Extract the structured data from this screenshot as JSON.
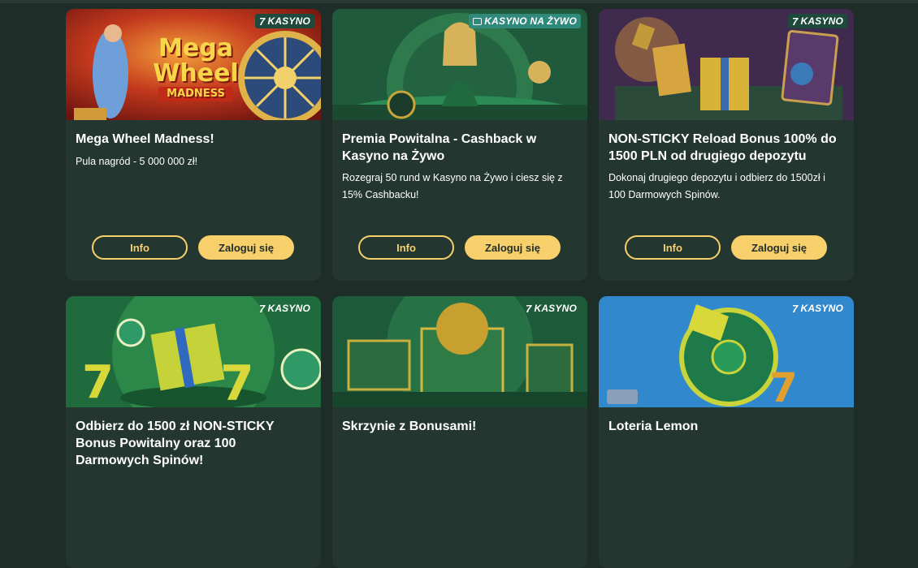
{
  "cards": [
    {
      "badge": "KASYNO",
      "badge_icon": "seven-icon",
      "image_text": {
        "line1": "Mega",
        "line2": "Wheel",
        "line3": "MADNESS"
      },
      "title": "Mega Wheel Madness!",
      "description": "Pula nagród - 5 000 000 zł!",
      "info_label": "Info",
      "login_label": "Zaloguj się"
    },
    {
      "badge": "KASYNO NA ŻYWO",
      "badge_icon": "live-casino-icon",
      "title": "Premia Powitalna - Cashback w Kasyno na Żywo",
      "description": "Rozegraj 50 rund w Kasyno na Żywo i ciesz się z 15% Cashbacku!",
      "info_label": "Info",
      "login_label": "Zaloguj się"
    },
    {
      "badge": "KASYNO",
      "badge_icon": "seven-icon",
      "title": "NON-STICKY Reload Bonus 100% do 1500 PLN od drugiego depozytu",
      "description": "Dokonaj drugiego depozytu i odbierz do 1500zł i 100 Darmowych Spinów.",
      "info_label": "Info",
      "login_label": "Zaloguj się"
    },
    {
      "badge": "KASYNO",
      "badge_icon": "seven-icon",
      "title": "Odbierz do 1500 zł NON-STICKY Bonus Powitalny oraz 100 Darmowych Spinów!"
    },
    {
      "badge": "KASYNO",
      "badge_icon": "seven-icon",
      "title": "Skrzynie z Bonusami!"
    },
    {
      "badge": "KASYNO",
      "badge_icon": "seven-icon",
      "title": "Loteria Lemon"
    }
  ],
  "colors": {
    "page_bg": "#1f2d29",
    "card_bg": "#243630",
    "accent": "#f7cf6b",
    "badge_bg": "#1d4a3c"
  }
}
